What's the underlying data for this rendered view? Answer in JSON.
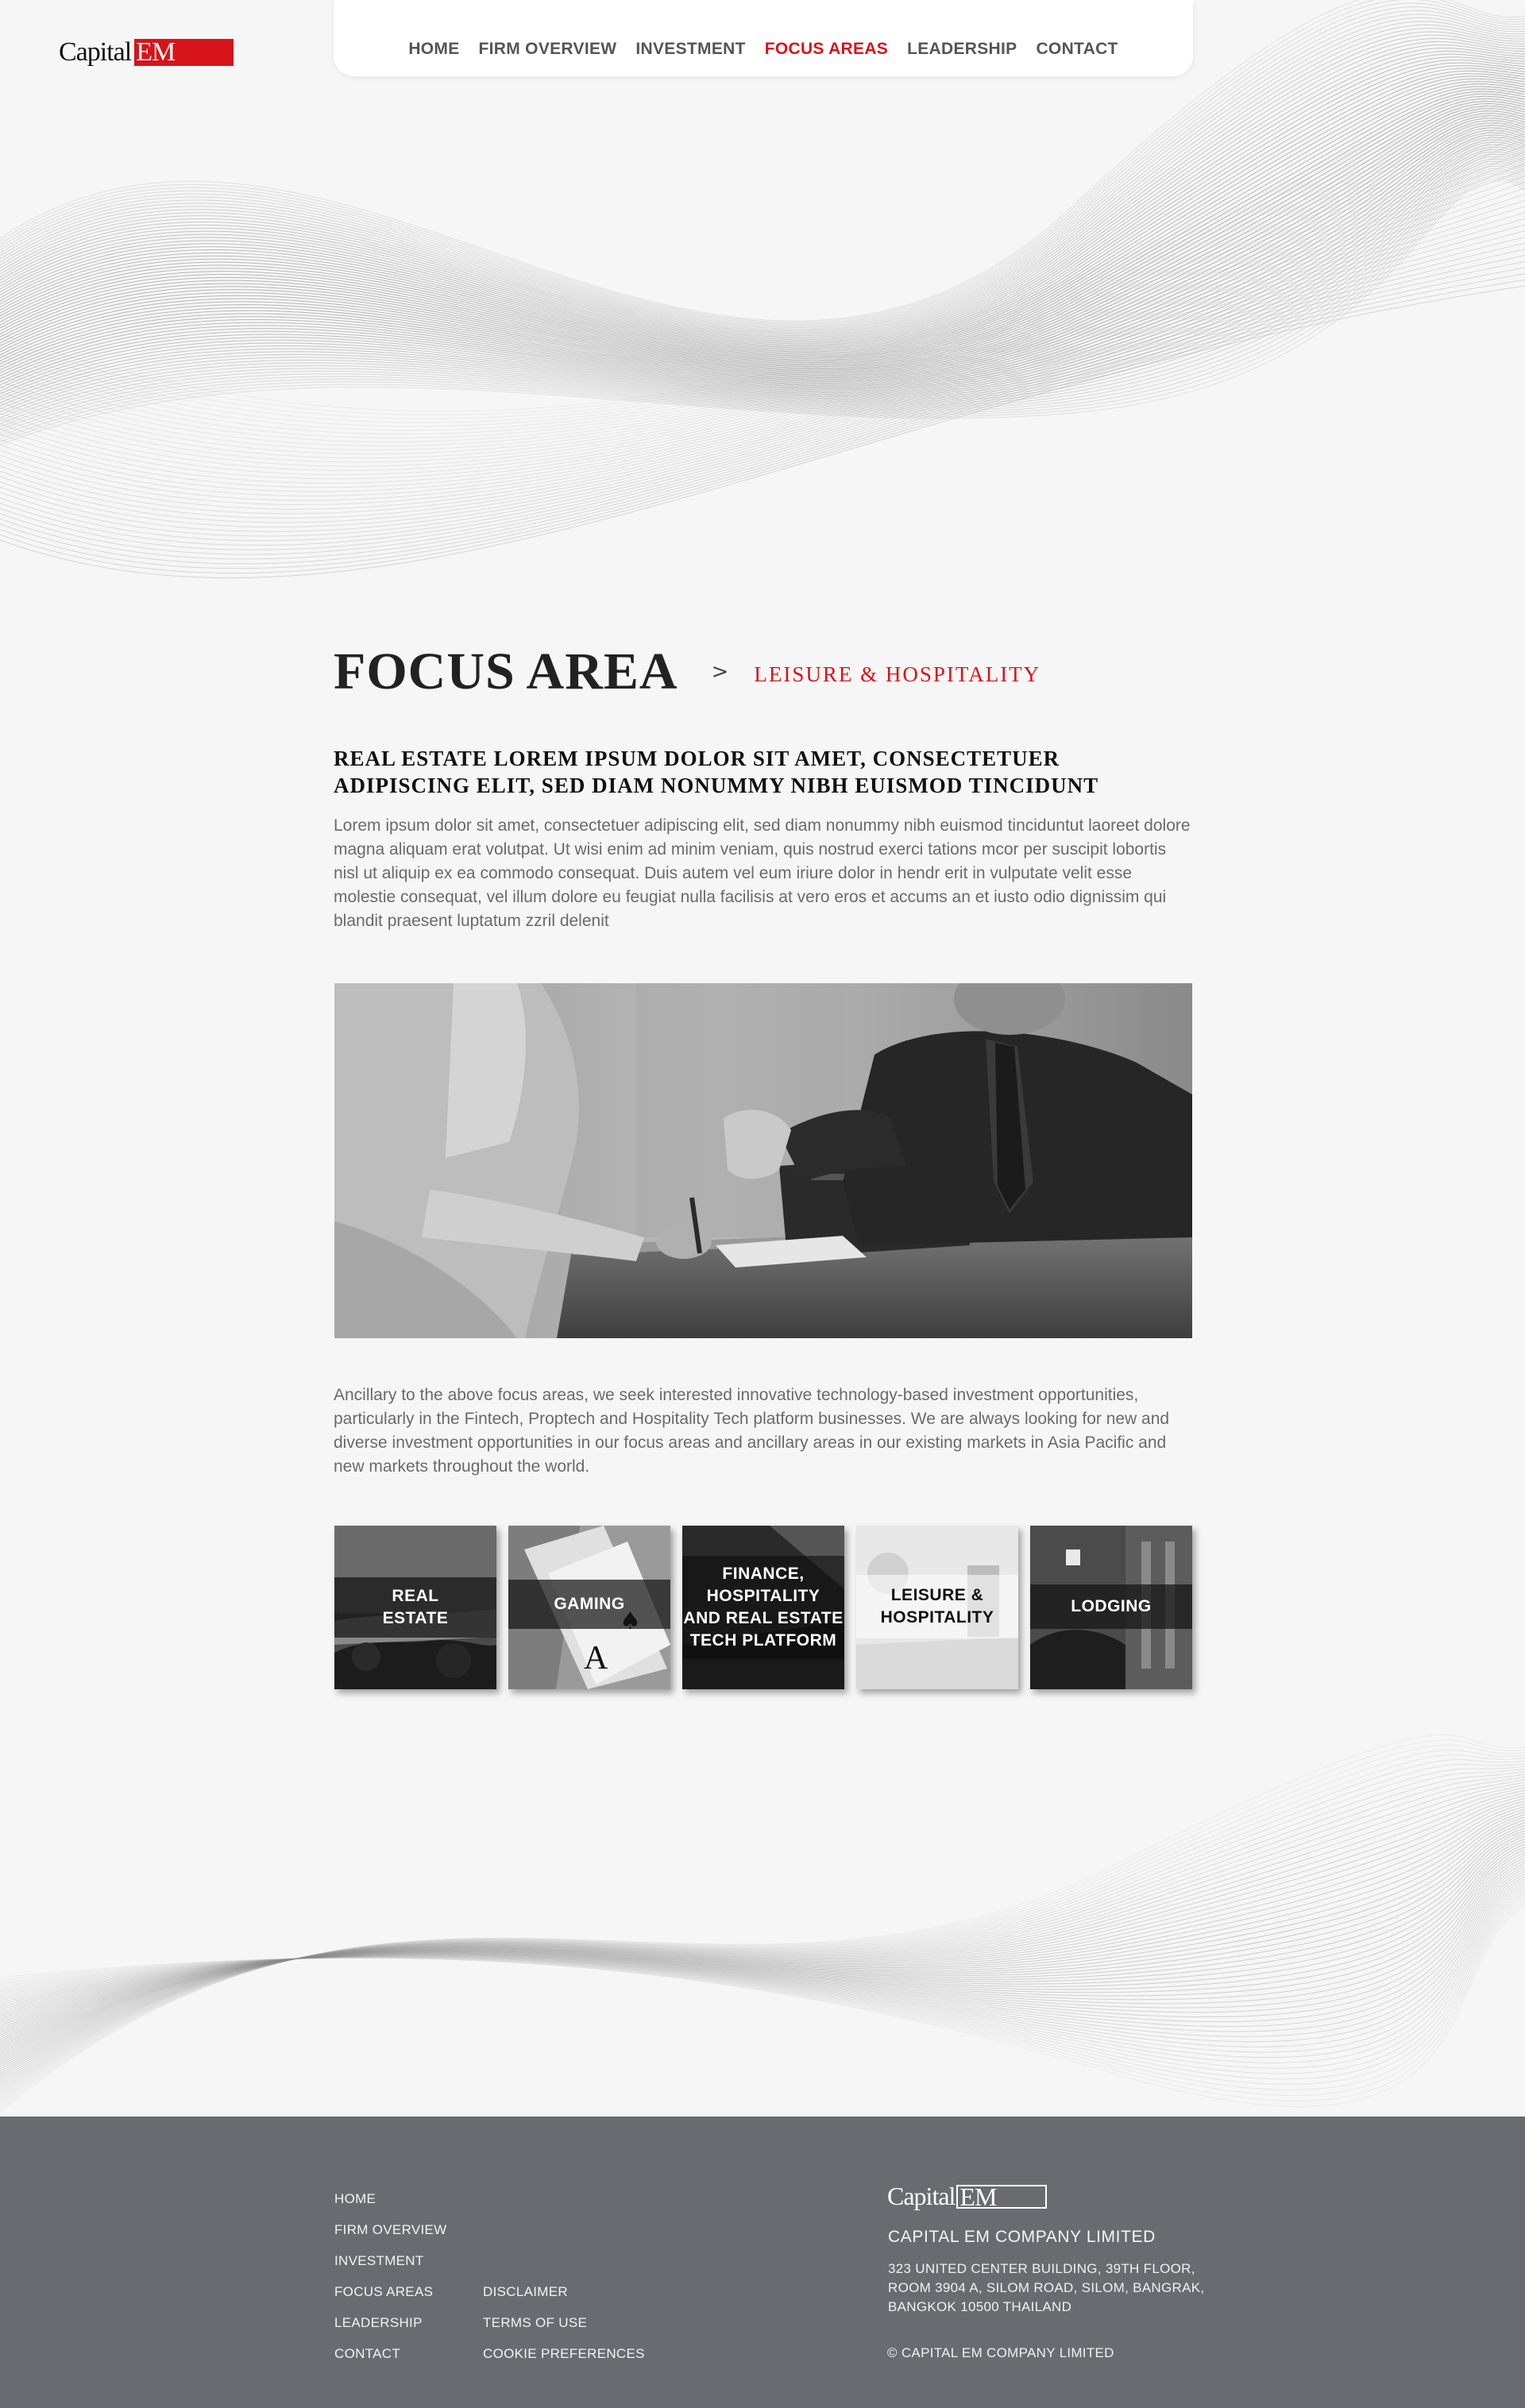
{
  "brand": {
    "logo_word": "Capital",
    "logo_em": "EM",
    "accent_color": "#d7141a"
  },
  "nav": {
    "items": [
      {
        "label": "HOME",
        "active": false
      },
      {
        "label": "FIRM OVERVIEW",
        "active": false
      },
      {
        "label": "INVESTMENT",
        "active": false
      },
      {
        "label": "FOCUS AREAS",
        "active": true
      },
      {
        "label": "LEADERSHIP",
        "active": false
      },
      {
        "label": "CONTACT",
        "active": false
      }
    ]
  },
  "main": {
    "title": "FOCUS AREA",
    "breadcrumb_separator": ">",
    "breadcrumb_current": "LEISURE  & HOSPITALITY",
    "subheading": "REAL ESTATE LOREM IPSUM DOLOR SIT AMET, CONSECTETUER ADIPISCING ELIT, SED DIAM NONUMMY NIBH EUISMOD TINCIDUNT",
    "paragraph1": "Lorem ipsum dolor sit amet, consectetuer adipiscing elit, sed diam nonummy nibh euismod tinciduntut laoreet dolore magna aliquam erat volutpat. Ut wisi enim ad minim veniam, quis nostrud exerci tations mcor per suscipit lobortis nisl ut aliquip ex ea commodo consequat. Duis autem vel eum iriure dolor in hendr erit in vulputate velit esse molestie consequat, vel illum dolore eu feugiat nulla facilisis at vero eros et accums an et iusto odio dignissim qui blandit praesent luptatum zzril delenit",
    "paragraph2": "Ancillary to the above focus areas, we seek interested innovative technology-based investment opportunities, particularly in the Fintech, Proptech and Hospitality Tech platform businesses. We are always looking for new and diverse investment opportunities in our focus areas and ancillary areas in our existing markets in Asia Pacific and new markets throughout the world."
  },
  "focus_tiles": [
    {
      "label": "REAL\nESTATE",
      "icon": "real-estate-photo"
    },
    {
      "label": "GAMING",
      "icon": "playing-cards-photo"
    },
    {
      "label": "FINANCE,\nHOSPITALITY\nAND REAL ESTATE\nTECH PLATFORM",
      "icon": "building-photo"
    },
    {
      "label": "LEISURE  &\nHOSPITALITY",
      "icon": "hotel-lobby-photo"
    },
    {
      "label": "LODGING",
      "icon": "apartment-photo"
    }
  ],
  "footer": {
    "links_col1": [
      "HOME",
      "FIRM OVERVIEW",
      "INVESTMENT",
      "FOCUS AREAS",
      "LEADERSHIP",
      "CONTACT"
    ],
    "links_col2": [
      "DISCLAIMER",
      "TERMS OF USE",
      "COOKIE PREFERENCES"
    ],
    "logo_word": "Capital",
    "logo_em": "EM",
    "company_name": "CAPITAL EM COMPANY LIMITED",
    "address_lines": [
      "323 UNITED CENTER BUILDING, 39TH FLOOR,",
      "ROOM 3904 A, SILOM ROAD, SILOM, BANGRAK,",
      "BANGKOK 10500 THAILAND"
    ],
    "copyright": "© CAPITAL EM COMPANY LIMITED",
    "background_color": "#696b70"
  }
}
